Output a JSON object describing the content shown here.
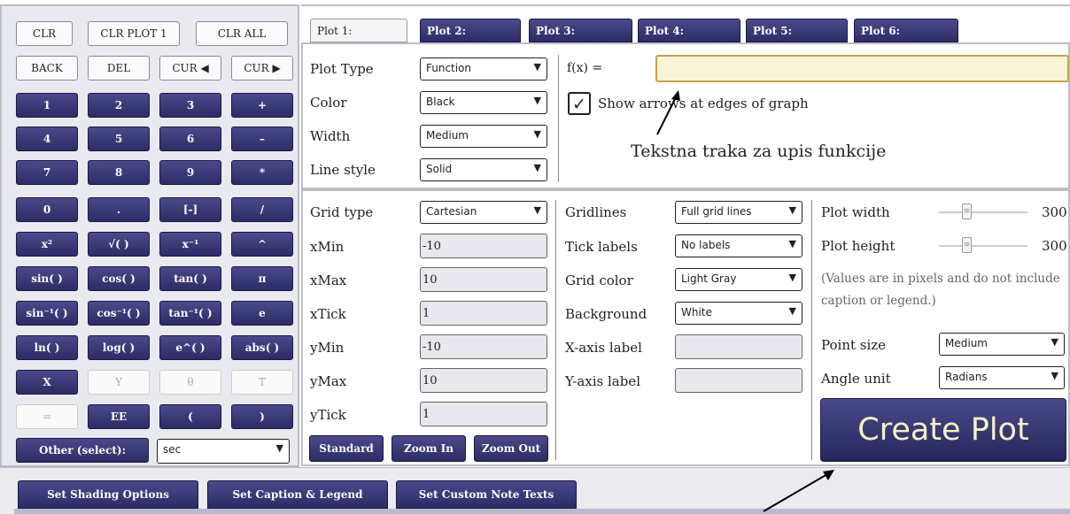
{
  "calc": {
    "rows": [
      [
        "CLR",
        "CLR PLOT 1",
        "CLR ALL"
      ],
      [
        "BACK",
        "DEL",
        "CUR ◀",
        "CUR ▶"
      ],
      [
        "1",
        "2",
        "3",
        "+"
      ],
      [
        "4",
        "5",
        "6",
        "–"
      ],
      [
        "7",
        "8",
        "9",
        "*"
      ],
      [
        "0",
        ".",
        "[-]",
        "/"
      ],
      [
        "x²",
        "√( )",
        "x⁻¹",
        "^"
      ],
      [
        "sin( )",
        "cos( )",
        "tan( )",
        "π"
      ],
      [
        "sin⁻¹( )",
        "cos⁻¹( )",
        "tan⁻¹( )",
        "e"
      ],
      [
        "ln( )",
        "log( )",
        "e^( )",
        "abs( )"
      ],
      [
        "X",
        "Y",
        "θ",
        "T"
      ],
      [
        "=",
        "EE",
        "(",
        ")"
      ]
    ],
    "other_label": "Other (select):",
    "other_value": "sec"
  },
  "tabs": [
    "Plot 1:",
    "Plot 2:",
    "Plot 3:",
    "Plot 4:",
    "Plot 5:",
    "Plot 6:"
  ],
  "plot": {
    "type_label": "Plot Type",
    "type_value": "Function",
    "color_label": "Color",
    "color_value": "Black",
    "width_label": "Width",
    "width_value": "Medium",
    "style_label": "Line style",
    "style_value": "Solid",
    "fx_label": "f(x) =",
    "arrows_label": "Show arrows at edges of graph"
  },
  "annotation": "Tekstna traka za upis funkcije",
  "grid": {
    "type_label": "Grid type",
    "type_value": "Cartesian",
    "xmin_label": "xMin",
    "xmin": "-10",
    "xmax_label": "xMax",
    "xmax": "10",
    "xtick_label": "xTick",
    "xtick": "1",
    "ymin_label": "yMin",
    "ymin": "-10",
    "ymax_label": "yMax",
    "ymax": "10",
    "ytick_label": "yTick",
    "ytick": "1",
    "standard": "Standard",
    "zoom_in": "Zoom In",
    "zoom_out": "Zoom Out"
  },
  "appearance": {
    "gridlines_label": "Gridlines",
    "gridlines_value": "Full grid lines",
    "ticks_label": "Tick labels",
    "ticks_value": "No labels",
    "gridcolor_label": "Grid color",
    "gridcolor_value": "Light Gray",
    "bg_label": "Background",
    "bg_value": "White",
    "xaxis_label": "X-axis label",
    "yaxis_label": "Y-axis label"
  },
  "size": {
    "width_label": "Plot width",
    "width_value": "300",
    "height_label": "Plot height",
    "height_value": "300",
    "note": "(Values are in pixels and do not include caption or legend.)",
    "point_label": "Point size",
    "point_value": "Medium",
    "angle_label": "Angle unit",
    "angle_value": "Radians",
    "create": "Create Plot"
  },
  "bottom": [
    "Set Shading Options",
    "Set Caption & Legend",
    "Set Custom Note Texts"
  ],
  "colors": {
    "button_dark": "#2c2c66",
    "input_yellow": "#f8f5d6",
    "input_border": "#c8a050"
  }
}
